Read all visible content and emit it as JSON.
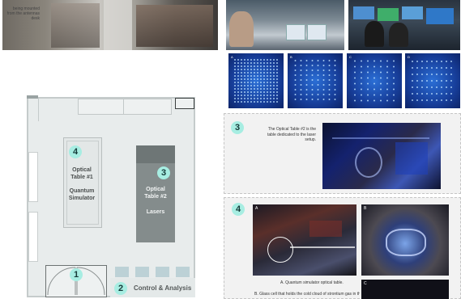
{
  "top_strip": {
    "caption": "being mounted from the antennas desk"
  },
  "floorplan": {
    "table1": {
      "number": "4",
      "line1": "Optical",
      "line2": "Table #1",
      "line3": "Quantum",
      "line4": "Simulator"
    },
    "table2": {
      "number": "3",
      "line1": "Optical",
      "line2": "Table #2",
      "line3": "Lasers"
    },
    "door": {
      "number": "1"
    },
    "control": {
      "number": "2",
      "label": "Control & Analysis"
    }
  },
  "image_panels": {
    "letters": [
      "A",
      "B",
      "C",
      "D"
    ]
  },
  "section3": {
    "number": "3",
    "text": "The Optical Table #2 is the table dedicated to the laser setup."
  },
  "section4": {
    "number": "4",
    "photo_a_tag": "A",
    "photo_b_tag": "B",
    "photo_c_tag": "C",
    "caption_a": "A.   Quantum simulator optical table.",
    "caption_b": "B.  Glass cell that holds the cold cloud of strontium gas in the middle,"
  }
}
